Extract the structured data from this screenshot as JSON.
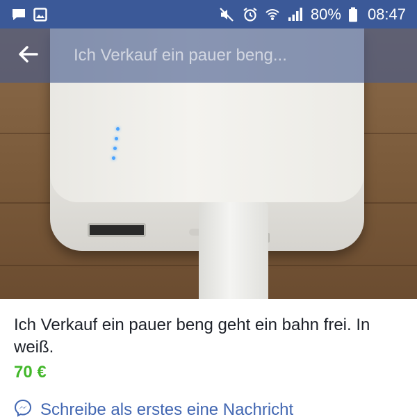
{
  "status_bar": {
    "battery_percent": "80%",
    "time": "08:47",
    "left_icons": [
      "chat-notification-icon",
      "image-notification-icon"
    ],
    "right_icons": [
      "mute-icon",
      "alarm-icon",
      "wifi-icon",
      "signal-icon",
      "battery-icon"
    ],
    "background": "#3b5998"
  },
  "app_bar": {
    "title": "Ich Verkauf ein pauer beng..."
  },
  "listing": {
    "title": "Ich Verkauf ein pauer beng geht ein bahn frei. In weiß.",
    "price": "70 €",
    "price_color": "#42b72a",
    "message_cta": "Schreibe als erstes eine Nachricht",
    "cta_color": "#4267b2",
    "photo": "white power bank with USB cable on wooden table"
  }
}
